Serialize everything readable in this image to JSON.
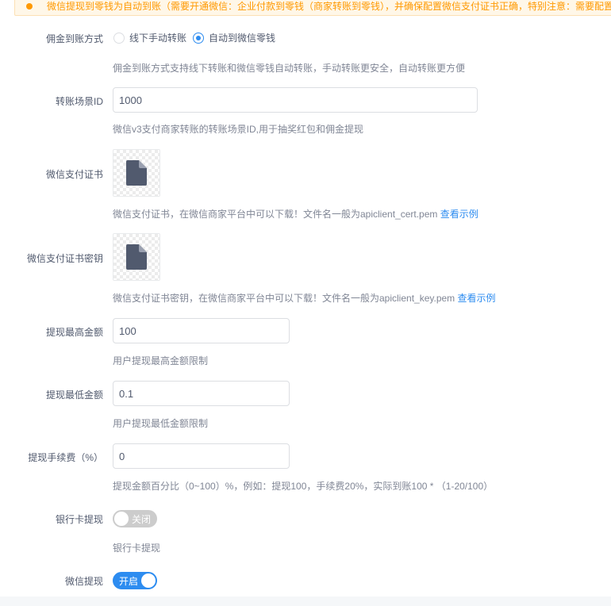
{
  "notice": {
    "text": "微信提现到零钱为自动到账（需要开通微信：企业付款到零钱（商家转账到零钱），并确保配置微信支付证书正确，特别注意：需要配置"
  },
  "commission_method": {
    "label": "佣金到账方式",
    "options": [
      {
        "label": "线下手动转账",
        "checked": false
      },
      {
        "label": "自动到微信零钱",
        "checked": true
      }
    ],
    "help": "佣金到账方式支持线下转账和微信零钱自动转账，手动转账更安全，自动转账更方便"
  },
  "transfer_scene": {
    "label": "转账场景ID",
    "value": "1000",
    "help": "微信v3支付商家转账的转账场景ID,用于抽奖红包和佣金提现"
  },
  "cert": {
    "label": "微信支付证书",
    "help": "微信支付证书，在微信商家平台中可以下载！文件名一般为apiclient_cert.pem",
    "link": "查看示例",
    "icon": "file-icon"
  },
  "cert_key": {
    "label": "微信支付证书密钥",
    "help": "微信支付证书密钥，在微信商家平台中可以下载！文件名一般为apiclient_key.pem",
    "link": "查看示例",
    "icon": "file-icon"
  },
  "max_amount": {
    "label": "提现最高金额",
    "value": "100",
    "help": "用户提现最高金额限制"
  },
  "min_amount": {
    "label": "提现最低金额",
    "value": "0.1",
    "help": "用户提现最低金额限制"
  },
  "fee": {
    "label": "提现手续费（%）",
    "value": "0",
    "help": "提现金额百分比（0~100）%，例如：提现100，手续费20%，实际到账100 * （1-20/100）"
  },
  "bank_withdraw": {
    "label": "银行卡提现",
    "state": "关闭",
    "enabled": false,
    "help": "银行卡提现"
  },
  "wechat_withdraw": {
    "label": "微信提现",
    "state": "开启",
    "enabled": true
  },
  "colors": {
    "accent": "#2d8cf0",
    "warning": "#ff9900",
    "text": "#515a6e",
    "help": "#808695"
  }
}
